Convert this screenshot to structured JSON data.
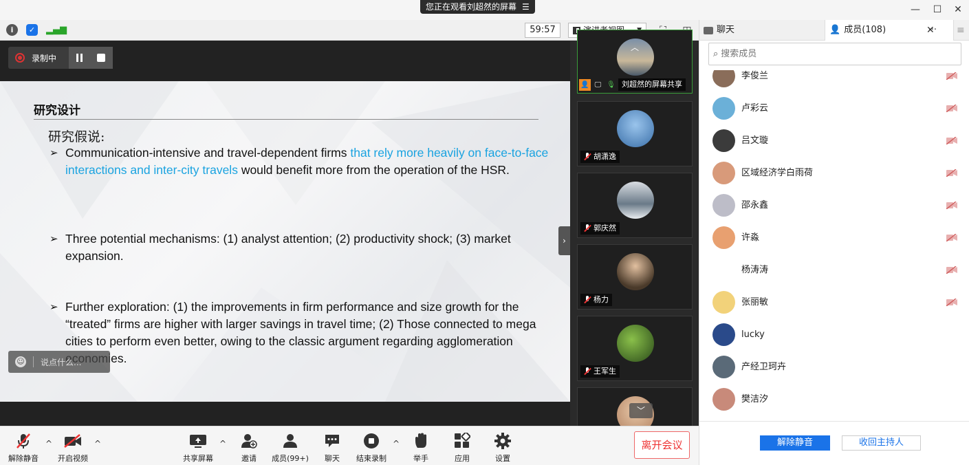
{
  "title_bar": {
    "banner_text": "您正在观看刘超然的屏幕",
    "banner_icon": "list-icon",
    "window_controls": [
      "minimize",
      "maximize",
      "close"
    ]
  },
  "toolbar": {
    "icons": [
      "info-icon",
      "shield-icon",
      "signal-icon"
    ],
    "timer": "59:57",
    "view_mode": "演讲者视图"
  },
  "recording": {
    "label": "录制中"
  },
  "slide": {
    "title": "研究设计",
    "subtitle": "研究假说:",
    "bullets": [
      {
        "pre": "Communication-intensive and travel-dependent firms ",
        "highlight": "that rely more heavily on face-to-face interactions and inter-city travels",
        "post": " would benefit more from the operation of the HSR."
      },
      {
        "pre": "Three potential mechanisms: (1)  analyst attention; (2)  productivity shock; (3) market expansion.",
        "highlight": "",
        "post": ""
      },
      {
        "pre": " Further exploration: (1) the improvements in firm performance and size growth for the “treated” firms are higher with larger savings in travel time; (2) Those connected to mega cities to perform even better, owing to the classic argument regarding agglomeration economies.",
        "highlight": "",
        "post": ""
      }
    ],
    "accent_color": "#1aa3e0"
  },
  "comment_box": {
    "placeholder": "说点什么..."
  },
  "video_strip": {
    "tiles": [
      {
        "name": "刘超然的屏幕共享",
        "active": true
      },
      {
        "name": "胡潇逸"
      },
      {
        "name": "郭庆然"
      },
      {
        "name": "杨力"
      },
      {
        "name": "王军生"
      }
    ]
  },
  "panel": {
    "chat_tab": "聊天",
    "members_tab": "成员(108)",
    "search_placeholder": "搜索成员",
    "members": [
      {
        "name": "李俊兰",
        "avatar_color": "#8a6d5a",
        "cam_off": true
      },
      {
        "name": "卢彩云",
        "avatar_color": "#6bb0d8",
        "cam_off": true
      },
      {
        "name": "吕文璇",
        "avatar_color": "#3b3b3b",
        "cam_off": true
      },
      {
        "name": "区域经济学白雨荷",
        "avatar_color": "#d89a7a",
        "cam_off": true
      },
      {
        "name": "邵永鑫",
        "avatar_color": "#bdbdc8",
        "cam_off": true
      },
      {
        "name": "许淼",
        "avatar_color": "#e8a070",
        "cam_off": true
      },
      {
        "name": "杨涛涛",
        "avatar_color": "#ffffff",
        "cam_off": true
      },
      {
        "name": "张丽敏",
        "avatar_color": "#f2d27a",
        "cam_off": true
      },
      {
        "name": "lucky",
        "avatar_color": "#2a4a8a",
        "cam_off": false
      },
      {
        "name": "产经卫珂卉",
        "avatar_color": "#5a6a78",
        "cam_off": false
      },
      {
        "name": "樊洁汐",
        "avatar_color": "#c88a7a",
        "cam_off": false
      }
    ],
    "unmute_all": "解除静音",
    "reclaim_host": "收回主持人"
  },
  "bottom_bar": {
    "unmute": "解除静音",
    "start_video": "开启视频",
    "share_screen": "共享屏幕",
    "invite": "邀请",
    "members": "成员(99+)",
    "chat": "聊天",
    "end_recording": "结束录制",
    "raise_hand": "举手",
    "apps": "应用",
    "settings": "设置",
    "leave": "离开会议"
  }
}
